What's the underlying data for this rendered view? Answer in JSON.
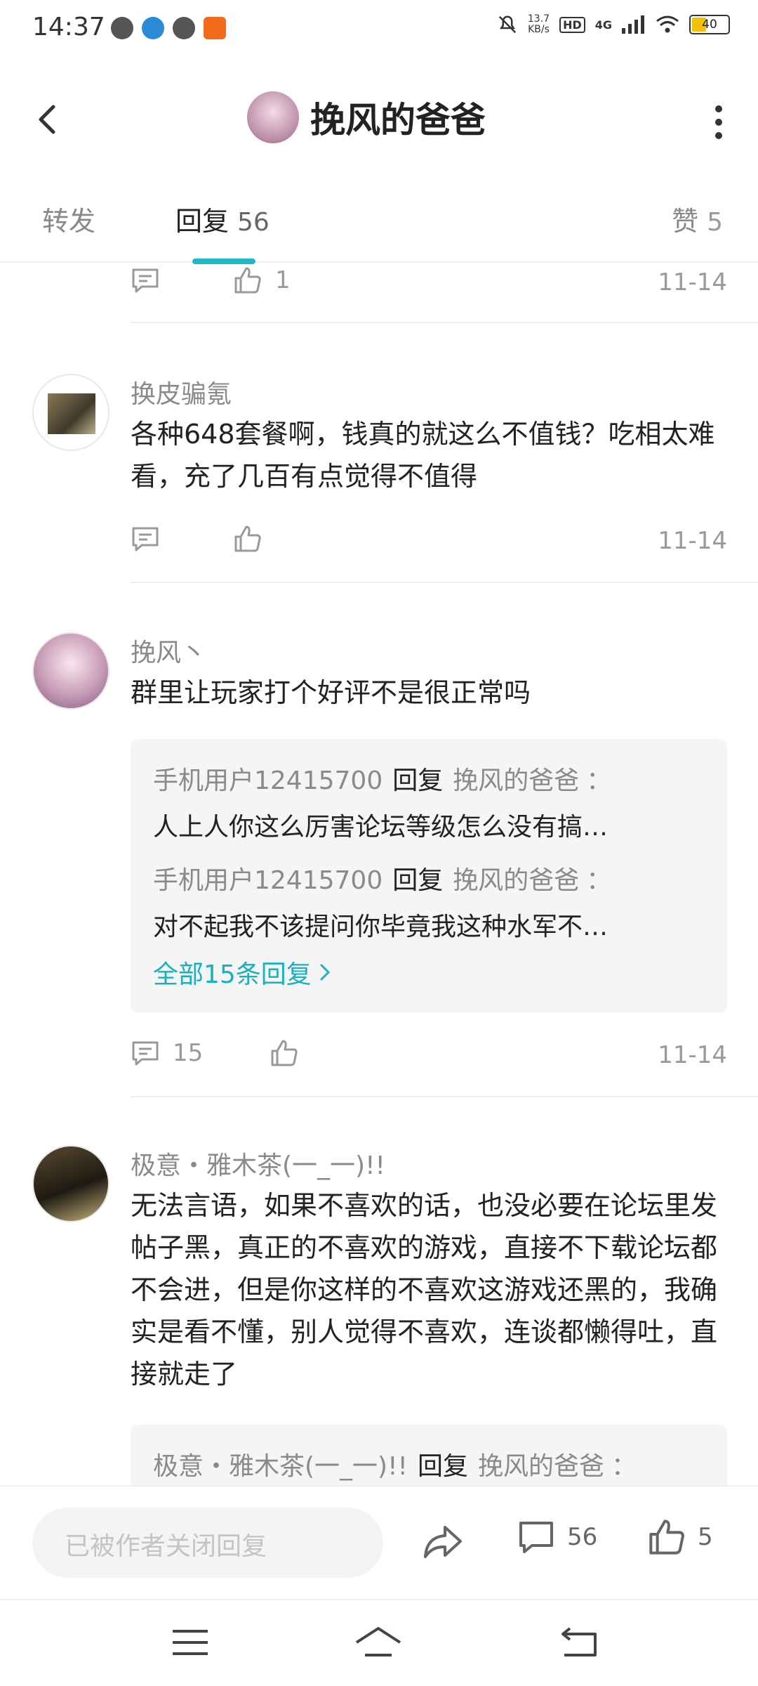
{
  "status_bar": {
    "time": "14:37",
    "speed_value": "13.7",
    "speed_unit": "KB/s",
    "hd": "HD",
    "network": "4G",
    "battery": "40",
    "battery_level": 0.4
  },
  "header": {
    "title": "挽风的爸爸"
  },
  "tabs": {
    "repost_label": "转发",
    "reply_label": "回复",
    "reply_count": "56",
    "like_label": "赞",
    "like_count": "5"
  },
  "top_action": {
    "like_count": "1",
    "date": "11-14"
  },
  "comments": [
    {
      "username": "换皮骗氪",
      "text": "各种648套餐啊，钱真的就这么不值钱？吃相太难看，充了几百有点觉得不值得",
      "date": "11-14"
    },
    {
      "username": "挽风丶",
      "text": "群里让玩家打个好评不是很正常吗",
      "replies": [
        {
          "from": "手机用户12415700",
          "verb": "回复",
          "to": "挽风的爸爸",
          "colon": "：",
          "text": "人上人你这么厉害论坛等级怎么没有搞…"
        },
        {
          "from": "手机用户12415700",
          "verb": "回复",
          "to": "挽风的爸爸",
          "colon": "：",
          "text": "对不起我不该提问你毕竟我这种水军不…"
        }
      ],
      "all_replies": "全部15条回复",
      "reply_count": "15",
      "date": "11-14"
    },
    {
      "username": "极意・雅木茶(一_一)!!",
      "text": "无法言语，如果不喜欢的话，也没必要在论坛里发帖子黑，真正的不喜欢的游戏，直接不下载论坛都不会进，但是你这样的不喜欢这游戏还黑的，我确实是看不懂，别人觉得不喜欢，连谈都懒得吐，直接就走了",
      "replies": [
        {
          "from": "极意・雅木茶(一_一)!!",
          "verb": "回复",
          "to": "挽风的爸爸",
          "colon": "："
        }
      ]
    }
  ],
  "bottom_bar": {
    "input_placeholder": "已被作者关闭回复",
    "comment_count": "56",
    "like_count": "5"
  },
  "colors": {
    "accent": "#1fb7c3",
    "link": "#1ab0bd",
    "muted": "#999999"
  }
}
